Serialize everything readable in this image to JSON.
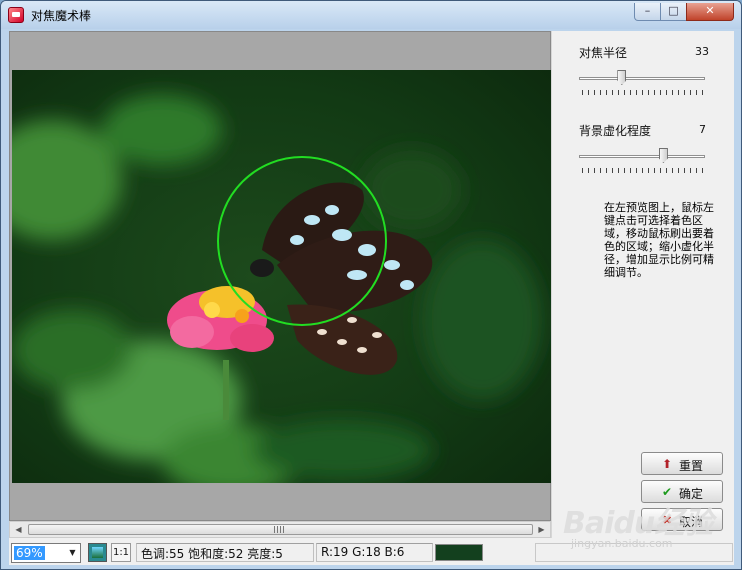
{
  "window": {
    "title": "对焦魔术棒",
    "minimize": "–",
    "maximize": "□",
    "close": "✕"
  },
  "panel": {
    "focus_radius": {
      "label": "对焦半径",
      "value": "33",
      "level": 0.34
    },
    "blur_degree": {
      "label": "背景虚化程度",
      "value": "7",
      "level": 0.67
    },
    "help": "在左预览图上，鼠标左键点击可选择着色区域，移动鼠标刷出要着色的区域；缩小虚化半径，增加显示比例可精细调节。",
    "buttons": [
      {
        "label": "重置",
        "icon": "up-arrow-icon"
      },
      {
        "label": "确定",
        "icon": "checkmark-icon"
      },
      {
        "label": "取消",
        "icon": "x-icon"
      }
    ]
  },
  "status": {
    "zoom": "69%",
    "zoom_arrow": "▼",
    "actual_size": "1:1",
    "hsl": "色调:55 饱和度:52 亮度:5",
    "rgb": "R:19 G:18 B:6",
    "color": "#13401e"
  },
  "scrollbar": {
    "left": "◀",
    "right": "▶"
  },
  "watermark": {
    "brand": "Baidu经验",
    "url": "jingyan.baidu.com"
  },
  "colors": {
    "focus_circle": "#22dd22"
  }
}
